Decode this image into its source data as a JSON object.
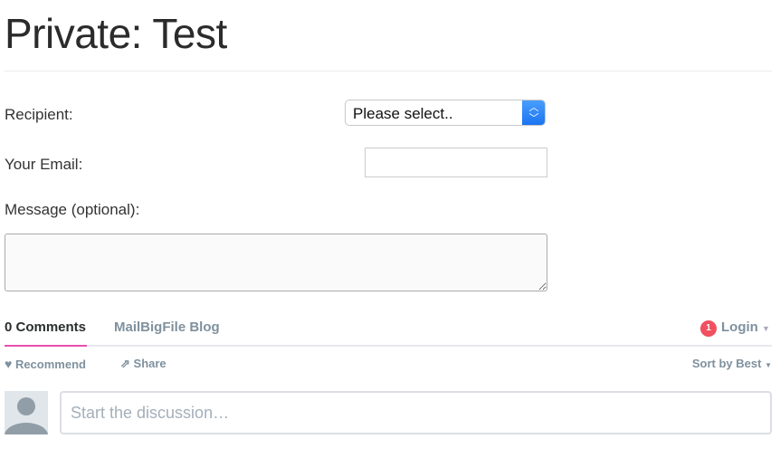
{
  "page": {
    "title": "Private: Test"
  },
  "form": {
    "recipient_label": "Recipient:",
    "recipient_value": "Please select..",
    "email_label": "Your Email:",
    "email_value": "",
    "message_label": "Message (optional):",
    "message_value": ""
  },
  "comments": {
    "tabs": [
      {
        "label": "0 Comments",
        "active": true
      },
      {
        "label": "MailBigFile Blog"
      }
    ],
    "login": "Login",
    "notification_count": "1",
    "recommend": "Recommend",
    "share": "Share",
    "sort": "Sort by Best",
    "placeholder": "Start the discussion…",
    "accent": "#e94fae",
    "badge_color": "#f05060"
  }
}
